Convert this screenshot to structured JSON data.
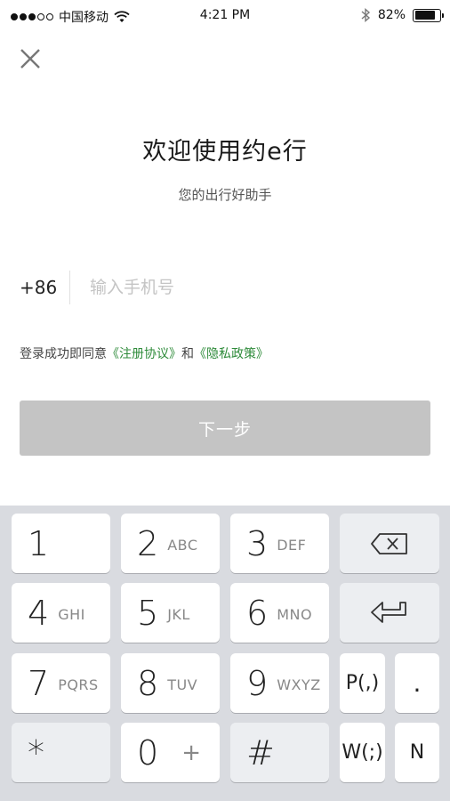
{
  "status_bar": {
    "carrier": "中国移动",
    "time": "4:21 PM",
    "battery_percent": "82%",
    "battery_level": 0.82
  },
  "header": {
    "close_icon": "close-icon"
  },
  "welcome": {
    "title": "欢迎使用约e行",
    "subtitle": "您的出行好助手"
  },
  "phone": {
    "country_code": "+86",
    "placeholder": "输入手机号",
    "value": ""
  },
  "agreement": {
    "prefix": "登录成功即同意",
    "terms_link": "《注册协议》",
    "and": "和",
    "privacy_link": "《隐私政策》"
  },
  "next_button": {
    "label": "下一步"
  },
  "keyboard": {
    "keys": {
      "k1": {
        "num": "1",
        "letters": ""
      },
      "k2": {
        "num": "2",
        "letters": "ABC"
      },
      "k3": {
        "num": "3",
        "letters": "DEF"
      },
      "k4": {
        "num": "4",
        "letters": "GHI"
      },
      "k5": {
        "num": "5",
        "letters": "JKL"
      },
      "k6": {
        "num": "6",
        "letters": "MNO"
      },
      "k7": {
        "num": "7",
        "letters": "PQRS"
      },
      "k8": {
        "num": "8",
        "letters": "TUV"
      },
      "k9": {
        "num": "9",
        "letters": "WXYZ"
      },
      "k0": {
        "num": "0",
        "letters": "+"
      },
      "star": "*",
      "hash": "#",
      "pause": "P(,)",
      "wait": "W(;)",
      "dot": ".",
      "n": "N"
    }
  }
}
